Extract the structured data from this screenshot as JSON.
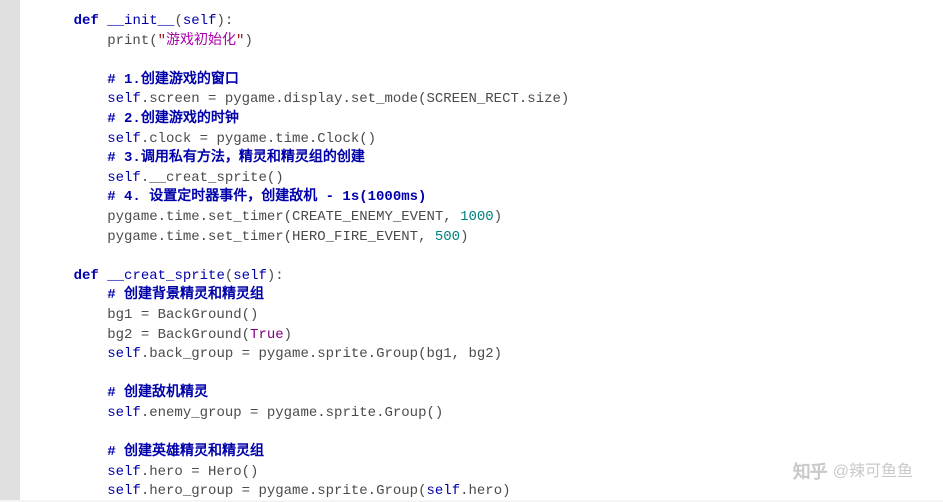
{
  "code": {
    "lines": [
      {
        "indent": 1,
        "tokens": [
          {
            "cls": "kw",
            "t": "def"
          },
          {
            "cls": "black",
            "t": " "
          },
          {
            "cls": "def-name",
            "t": "__init__"
          },
          {
            "cls": "black",
            "t": "("
          },
          {
            "cls": "self",
            "t": "self"
          },
          {
            "cls": "black",
            "t": "):"
          }
        ]
      },
      {
        "indent": 2,
        "tokens": [
          {
            "cls": "black",
            "t": "print("
          },
          {
            "cls": "str",
            "t": "\""
          },
          {
            "cls": "cn-str",
            "t": "游戏初始化"
          },
          {
            "cls": "str",
            "t": "\""
          },
          {
            "cls": "black",
            "t": ")"
          }
        ]
      },
      {
        "indent": 0,
        "tokens": []
      },
      {
        "indent": 2,
        "tokens": [
          {
            "cls": "comment-cn",
            "t": "# 1.创建游戏的窗口"
          }
        ]
      },
      {
        "indent": 2,
        "tokens": [
          {
            "cls": "self",
            "t": "self"
          },
          {
            "cls": "black",
            "t": ".screen = pygame.display.set_mode(SCREEN_RECT.size)"
          }
        ]
      },
      {
        "indent": 2,
        "tokens": [
          {
            "cls": "comment-cn",
            "t": "# 2.创建游戏的时钟"
          }
        ]
      },
      {
        "indent": 2,
        "tokens": [
          {
            "cls": "self",
            "t": "self"
          },
          {
            "cls": "black",
            "t": ".clock = pygame.time.Clock()"
          }
        ]
      },
      {
        "indent": 2,
        "tokens": [
          {
            "cls": "comment-cn",
            "t": "# 3.调用私有方法，精灵和精灵组的创建"
          }
        ]
      },
      {
        "indent": 2,
        "tokens": [
          {
            "cls": "self",
            "t": "self"
          },
          {
            "cls": "black",
            "t": ".__creat_sprite()"
          }
        ]
      },
      {
        "indent": 2,
        "tokens": [
          {
            "cls": "comment-cn",
            "t": "# 4. 设置定时器事件，创建敌机 - 1s(1000ms)"
          }
        ]
      },
      {
        "indent": 2,
        "tokens": [
          {
            "cls": "black",
            "t": "pygame.time.set_timer(CREATE_ENEMY_EVENT, "
          },
          {
            "cls": "num",
            "t": "1000"
          },
          {
            "cls": "black",
            "t": ")"
          }
        ]
      },
      {
        "indent": 2,
        "tokens": [
          {
            "cls": "black",
            "t": "pygame.time.set_timer(HERO_FIRE_EVENT, "
          },
          {
            "cls": "num",
            "t": "500"
          },
          {
            "cls": "black",
            "t": ")"
          }
        ]
      },
      {
        "indent": 0,
        "tokens": []
      },
      {
        "indent": 1,
        "tokens": [
          {
            "cls": "kw",
            "t": "def"
          },
          {
            "cls": "black",
            "t": " "
          },
          {
            "cls": "def-name",
            "t": "__creat_sprite"
          },
          {
            "cls": "black",
            "t": "("
          },
          {
            "cls": "self",
            "t": "self"
          },
          {
            "cls": "black",
            "t": "):"
          }
        ]
      },
      {
        "indent": 2,
        "tokens": [
          {
            "cls": "comment-cn",
            "t": "# 创建背景精灵和精灵组"
          }
        ]
      },
      {
        "indent": 2,
        "tokens": [
          {
            "cls": "black",
            "t": "bg1 = BackGround()"
          }
        ]
      },
      {
        "indent": 2,
        "tokens": [
          {
            "cls": "black",
            "t": "bg2 = BackGround("
          },
          {
            "cls": "bool",
            "t": "True"
          },
          {
            "cls": "black",
            "t": ")"
          }
        ]
      },
      {
        "indent": 2,
        "tokens": [
          {
            "cls": "self",
            "t": "self"
          },
          {
            "cls": "black",
            "t": ".back_group = pygame.sprite.Group(bg1, bg2)"
          }
        ]
      },
      {
        "indent": 0,
        "tokens": []
      },
      {
        "indent": 2,
        "tokens": [
          {
            "cls": "comment-cn",
            "t": "# 创建敌机精灵"
          }
        ]
      },
      {
        "indent": 2,
        "tokens": [
          {
            "cls": "self",
            "t": "self"
          },
          {
            "cls": "black",
            "t": ".enemy_group = pygame.sprite.Group()"
          }
        ]
      },
      {
        "indent": 0,
        "tokens": []
      },
      {
        "indent": 2,
        "tokens": [
          {
            "cls": "comment-cn",
            "t": "# 创建英雄精灵和精灵组"
          }
        ]
      },
      {
        "indent": 2,
        "tokens": [
          {
            "cls": "self",
            "t": "self"
          },
          {
            "cls": "black",
            "t": ".hero = Hero()"
          }
        ]
      },
      {
        "indent": 2,
        "tokens": [
          {
            "cls": "self",
            "t": "self"
          },
          {
            "cls": "black",
            "t": ".hero_group = pygame.sprite.Group("
          },
          {
            "cls": "self",
            "t": "self"
          },
          {
            "cls": "black",
            "t": ".hero)"
          }
        ]
      }
    ]
  },
  "watermark": {
    "brand": "知乎",
    "author": "@辣可鱼鱼"
  }
}
